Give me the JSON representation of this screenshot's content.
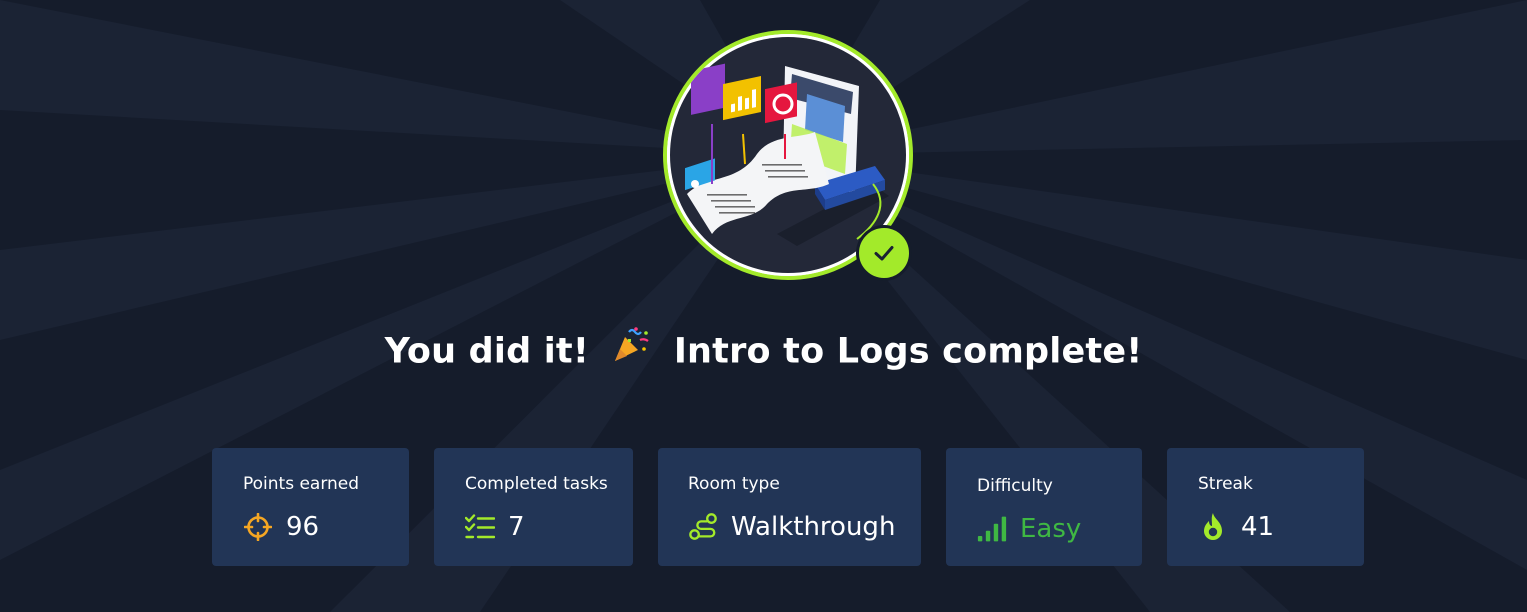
{
  "headline": {
    "before": "You did it!",
    "after": "Intro to Logs complete!"
  },
  "stats": [
    {
      "label": "Points earned",
      "value": "96",
      "icon": "crosshair-icon"
    },
    {
      "label": "Completed tasks",
      "value": "7",
      "icon": "checklist-icon"
    },
    {
      "label": "Room type",
      "value": "Walkthrough",
      "icon": "route-icon"
    },
    {
      "label": "Difficulty",
      "value": "Easy",
      "icon": "signal-bars-icon"
    },
    {
      "label": "Streak",
      "value": "41",
      "icon": "flame-icon"
    }
  ],
  "colors": {
    "background": "#151c2b",
    "card": "#223556",
    "accent": "#a3ea2a",
    "points_icon": "#f5a623",
    "easy": "#3fb843"
  }
}
